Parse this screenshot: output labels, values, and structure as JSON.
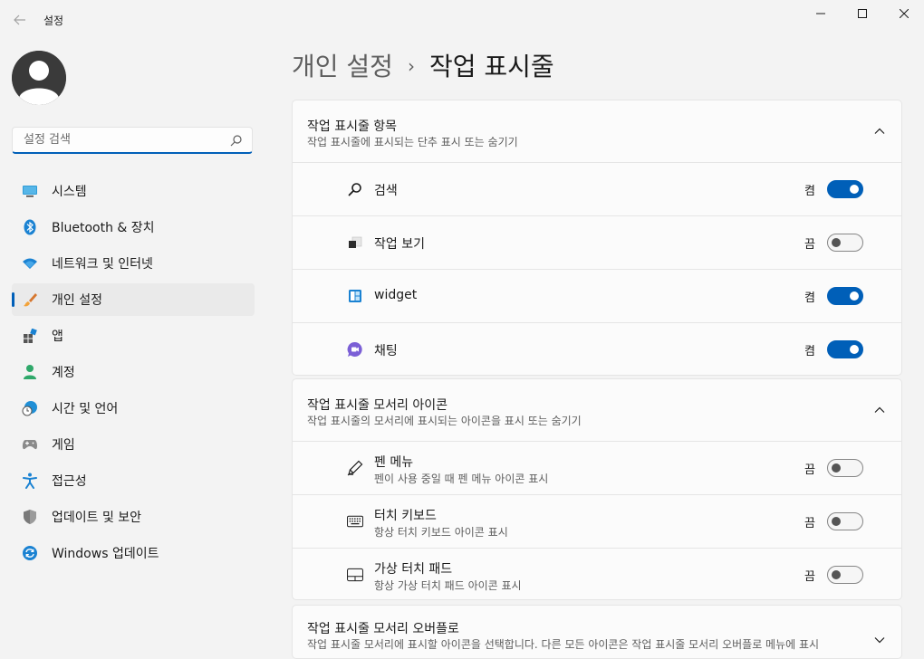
{
  "window": {
    "app_title": "설정",
    "back_icon": "arrow-left-icon",
    "minimize_icon": "minimize-icon",
    "maximize_icon": "maximize-icon",
    "close_icon": "close-icon"
  },
  "sidebar": {
    "search_placeholder": "설정 검색",
    "items": [
      {
        "label": "시스템",
        "icon": "monitor-icon"
      },
      {
        "label": "Bluetooth & 장치",
        "icon": "bluetooth-icon"
      },
      {
        "label": "네트워크 및 인터넷",
        "icon": "wifi-icon"
      },
      {
        "label": "개인 설정",
        "icon": "brush-icon",
        "selected": true
      },
      {
        "label": "앱",
        "icon": "apps-icon"
      },
      {
        "label": "계정",
        "icon": "person-icon"
      },
      {
        "label": "시간 및 언어",
        "icon": "clock-globe-icon"
      },
      {
        "label": "게임",
        "icon": "gamepad-icon"
      },
      {
        "label": "접근성",
        "icon": "accessibility-icon"
      },
      {
        "label": "업데이트 및 보안",
        "icon": "shield-icon"
      },
      {
        "label": "Windows 업데이트",
        "icon": "sync-icon"
      }
    ]
  },
  "breadcrumb": {
    "parent": "개인 설정",
    "separator": "›",
    "current": "작업 표시줄"
  },
  "sections": {
    "taskbar_items": {
      "title": "작업 표시줄 항목",
      "subtitle": "작업 표시줄에 표시되는 단추 표시 또는 숨기기",
      "rows": [
        {
          "label": "검색",
          "state": "켬",
          "on": true,
          "icon": "search-icon"
        },
        {
          "label": "작업 보기",
          "state": "끔",
          "on": false,
          "icon": "task-view-icon"
        },
        {
          "label": "widget",
          "state": "켬",
          "on": true,
          "icon": "widgets-icon"
        },
        {
          "label": "채팅",
          "state": "켬",
          "on": true,
          "icon": "chat-icon"
        }
      ]
    },
    "corner_icons": {
      "title": "작업 표시줄 모서리 아이콘",
      "subtitle": "작업 표시줄의 모서리에 표시되는 아이콘을 표시 또는 숨기기",
      "rows": [
        {
          "label": "펜 메뉴",
          "desc": "펜이 사용 중일 때 펜 메뉴 아이콘 표시",
          "state": "끔",
          "on": false,
          "icon": "pen-icon"
        },
        {
          "label": "터치 키보드",
          "desc": "항상 터치 키보드 아이콘 표시",
          "state": "끔",
          "on": false,
          "icon": "keyboard-icon"
        },
        {
          "label": "가상 터치 패드",
          "desc": "항상 가상 터치 패드 아이콘 표시",
          "state": "끔",
          "on": false,
          "icon": "touchpad-icon"
        }
      ]
    },
    "corner_overflow": {
      "title": "작업 표시줄 모서리 오버플로",
      "subtitle": "작업 표시줄 모서리에 표시할 아이콘을 선택합니다. 다른 모든 아이콘은 작업 표시줄 모서리 오버플로 메뉴에 표시"
    }
  },
  "colors": {
    "accent": "#005fb8",
    "background": "#f3f3f3",
    "card": "#fbfbfb"
  }
}
